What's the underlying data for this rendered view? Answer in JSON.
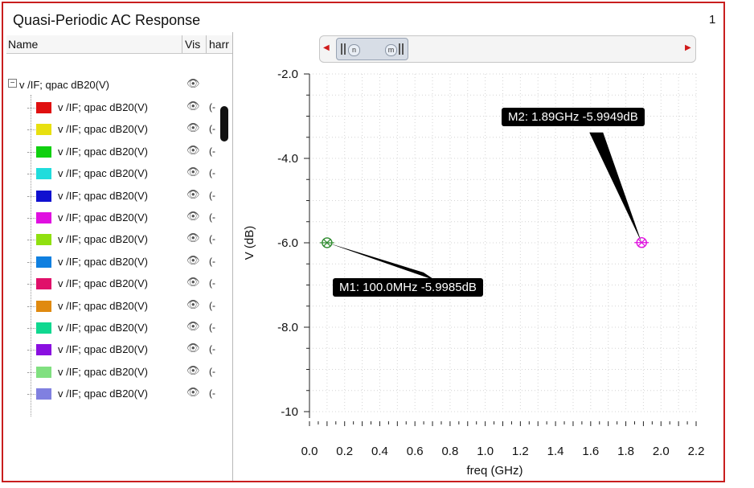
{
  "window": {
    "title": "Quasi-Periodic AC Response",
    "page_number": "1"
  },
  "tree": {
    "columns": {
      "name": "Name",
      "vis": "Vis",
      "harm": "harr"
    },
    "parent": {
      "label": "v /IF; qpac dB20(V)"
    },
    "rows": [
      {
        "label": "v /IF; qpac dB20(V)",
        "color": "#e01010",
        "harm": "(-"
      },
      {
        "label": "v /IF; qpac dB20(V)",
        "color": "#e8e010",
        "harm": "(-"
      },
      {
        "label": "v /IF; qpac dB20(V)",
        "color": "#10d010",
        "harm": "(-"
      },
      {
        "label": "v /IF; qpac dB20(V)",
        "color": "#20dcdc",
        "harm": "(-"
      },
      {
        "label": "v /IF; qpac dB20(V)",
        "color": "#1010d0",
        "harm": "(-"
      },
      {
        "label": "v /IF; qpac dB20(V)",
        "color": "#e010e0",
        "harm": "(-"
      },
      {
        "label": "v /IF; qpac dB20(V)",
        "color": "#90e010",
        "harm": "(-"
      },
      {
        "label": "v /IF; qpac dB20(V)",
        "color": "#1080e0",
        "harm": "(-"
      },
      {
        "label": "v /IF; qpac dB20(V)",
        "color": "#e0106a",
        "harm": "(-"
      },
      {
        "label": "v /IF; qpac dB20(V)",
        "color": "#e08a10",
        "harm": "(-"
      },
      {
        "label": "v /IF; qpac dB20(V)",
        "color": "#10d890",
        "harm": "(-"
      },
      {
        "label": "v /IF; qpac dB20(V)",
        "color": "#8a10e0",
        "harm": "(-"
      },
      {
        "label": "v /IF; qpac dB20(V)",
        "color": "#80e080",
        "harm": "(-"
      },
      {
        "label": "v /IF; qpac dB20(V)",
        "color": "#8080e0",
        "harm": "(-"
      }
    ]
  },
  "slider": {
    "left_handle": "n",
    "right_handle": "m"
  },
  "chart_data": {
    "type": "scatter",
    "xlabel": "freq (GHz)",
    "ylabel": "V (dB)",
    "xlim": [
      0.0,
      2.2
    ],
    "ylim": [
      -10,
      -2.0
    ],
    "x_ticks": [
      "0.0",
      "0.2",
      "0.4",
      "0.6",
      "0.8",
      "1.0",
      "1.2",
      "1.4",
      "1.6",
      "1.8",
      "2.0",
      "2.2"
    ],
    "y_ticks": [
      {
        "value": -2.0,
        "label": "-2.0"
      },
      {
        "value": -4.0,
        "label": "-4.0"
      },
      {
        "value": -6.0,
        "label": "-6.0"
      },
      {
        "value": -8.0,
        "label": "-8.0"
      },
      {
        "value": -10,
        "label": "-10"
      }
    ],
    "grid": true,
    "points": [
      {
        "x": 0.1,
        "y": -5.9985,
        "color": "#2e8b2e"
      },
      {
        "x": 1.89,
        "y": -5.9949,
        "color": "#e010e0"
      }
    ],
    "markers": [
      {
        "text": "M1: 100.0MHz -5.9985dB"
      },
      {
        "text": "M2: 1.89GHz -5.9949dB"
      }
    ]
  }
}
